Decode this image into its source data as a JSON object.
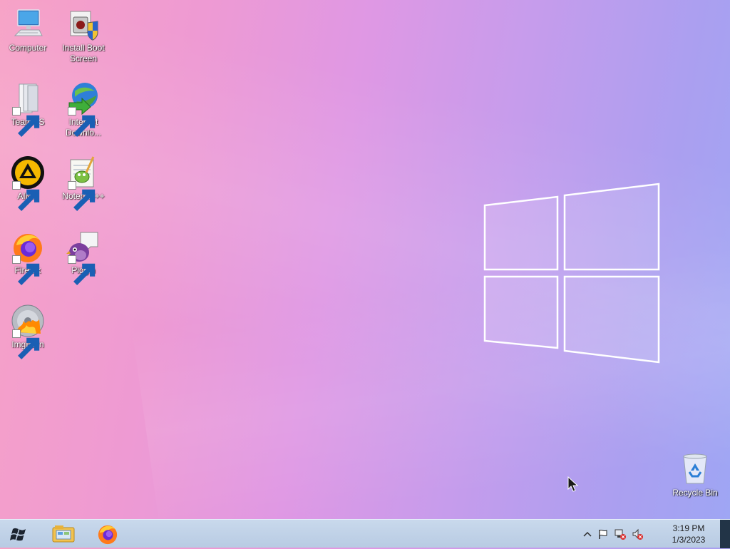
{
  "desktop_icons": [
    {
      "label": "Computer",
      "icon": "computer-icon"
    },
    {
      "label": "Install Boot Screen",
      "icon": "installer-icon"
    },
    {
      "label": "TeamOS",
      "icon": "folder-icon"
    },
    {
      "label": "Internet Downlo...",
      "icon": "idm-icon"
    },
    {
      "label": "AIMP",
      "icon": "aimp-icon"
    },
    {
      "label": "Notepad++",
      "icon": "notepadpp-icon"
    },
    {
      "label": "Firefox",
      "icon": "firefox-icon"
    },
    {
      "label": "Pidgin",
      "icon": "pidgin-icon"
    },
    {
      "label": "ImgBurn",
      "icon": "imgburn-icon"
    }
  ],
  "recycle_bin": {
    "label": "Recycle Bin",
    "icon": "recycle-bin-icon"
  },
  "taskbar": {
    "start_icon": "windows-start-icon",
    "pinned": [
      "file-explorer-icon",
      "firefox-icon"
    ],
    "tray_icons": [
      "chevron-up-icon",
      "action-center-flag-icon",
      "network-error-icon",
      "volume-muted-icon"
    ],
    "time": "3:19 PM",
    "date": "1/3/2023"
  },
  "colors": {
    "wallpaper_left": "#f7a2c6",
    "wallpaper_mid": "#df98e4",
    "wallpaper_right": "#9ea6f4",
    "taskbar": "#c3d4ea"
  }
}
